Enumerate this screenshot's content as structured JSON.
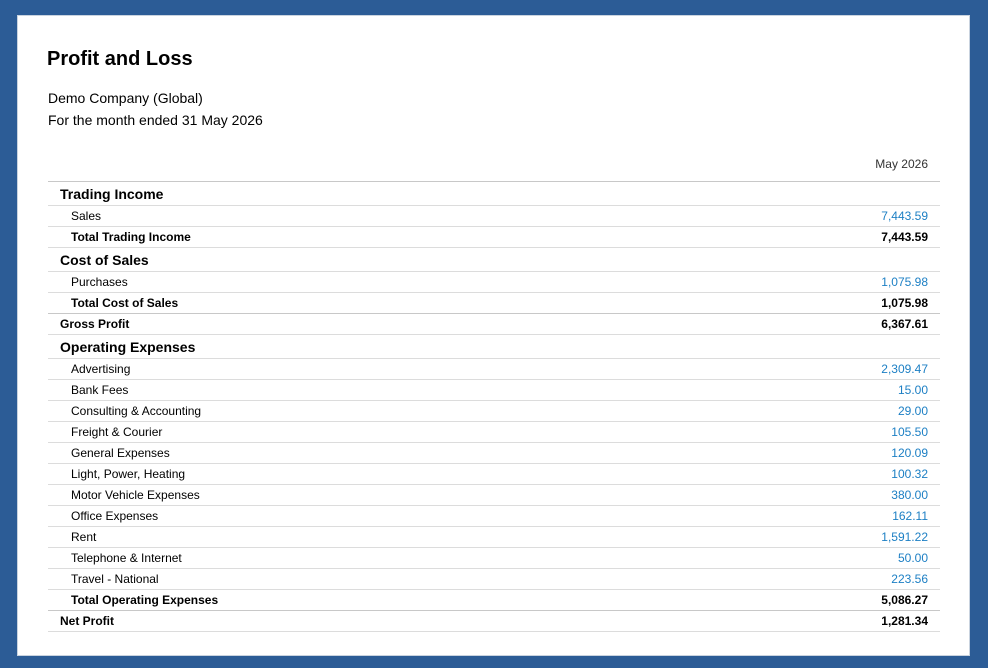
{
  "report": {
    "title": "Profit and Loss",
    "organisation": "Demo Company (Global)",
    "period": "For the month ended 31 May 2026",
    "column_header": "May 2026"
  },
  "trading_income": {
    "heading": "Trading Income",
    "items": [
      {
        "label": "Sales",
        "value": "7,443.59"
      }
    ],
    "total_label": "Total Trading Income",
    "total_value": "7,443.59"
  },
  "cost_of_sales": {
    "heading": "Cost of Sales",
    "items": [
      {
        "label": "Purchases",
        "value": "1,075.98"
      }
    ],
    "total_label": "Total Cost of Sales",
    "total_value": "1,075.98"
  },
  "gross_profit": {
    "label": "Gross Profit",
    "value": "6,367.61"
  },
  "operating_expenses": {
    "heading": "Operating Expenses",
    "items": [
      {
        "label": "Advertising",
        "value": "2,309.47"
      },
      {
        "label": "Bank Fees",
        "value": "15.00"
      },
      {
        "label": "Consulting & Accounting",
        "value": "29.00"
      },
      {
        "label": "Freight & Courier",
        "value": "105.50"
      },
      {
        "label": "General Expenses",
        "value": "120.09"
      },
      {
        "label": "Light, Power, Heating",
        "value": "100.32"
      },
      {
        "label": "Motor Vehicle Expenses",
        "value": "380.00"
      },
      {
        "label": "Office Expenses",
        "value": "162.11"
      },
      {
        "label": "Rent",
        "value": "1,591.22"
      },
      {
        "label": "Telephone & Internet",
        "value": "50.00"
      },
      {
        "label": "Travel - National",
        "value": "223.56"
      }
    ],
    "total_label": "Total Operating Expenses",
    "total_value": "5,086.27"
  },
  "net_profit": {
    "label": "Net Profit",
    "value": "1,281.34"
  },
  "colors": {
    "frame": "#2c5c96",
    "link": "#1c7fc4"
  }
}
